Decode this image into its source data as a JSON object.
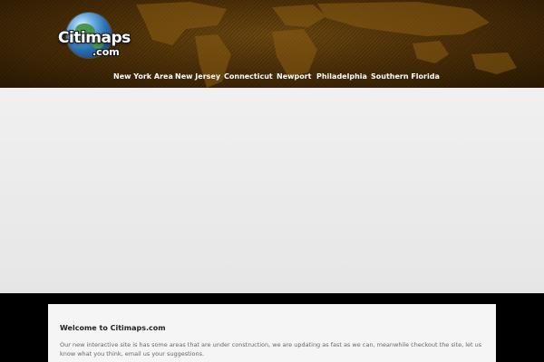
{
  "logo": {
    "word": "Citimaps",
    "tld": ".com"
  },
  "nav": {
    "items": [
      {
        "label": "New York Area"
      },
      {
        "label": "New Jersey"
      },
      {
        "label": "Connecticut"
      },
      {
        "label": "Newport"
      },
      {
        "label": "Philadelphia"
      },
      {
        "label": "Southern Florida"
      }
    ]
  },
  "welcome": {
    "title": "Welcome to Citimaps.com",
    "body": "Our new interactive  site is has some areas that are under construction, we are updating as fast as we can, meanwhile checkout the site, let us know what you think, email us your suggestions."
  },
  "colors": {
    "header_brown": "#4d3008",
    "nav_text": "#ffffff",
    "banner": "#eeeeee",
    "page_bg": "#000000"
  }
}
